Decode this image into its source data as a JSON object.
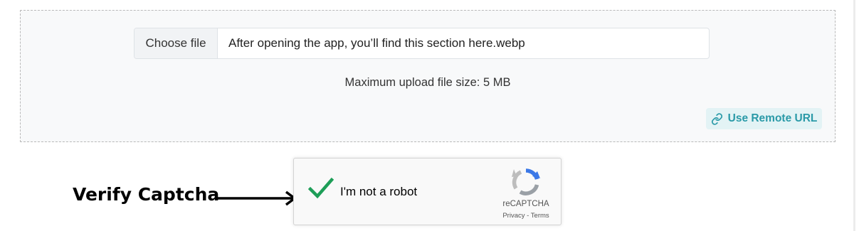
{
  "upload": {
    "choose_file_label": "Choose file",
    "file_name": "After opening the app, you’ll find this section here.webp",
    "max_size_text": "Maximum upload file size: 5 MB",
    "remote_url_label": "Use Remote URL"
  },
  "annotation": {
    "label": "Verify Captcha"
  },
  "recaptcha": {
    "label": "I'm not a robot",
    "brand": "reCAPTCHA",
    "privacy_link": "Privacy",
    "separator": "-",
    "terms_link": "Terms",
    "checked": true
  },
  "colors": {
    "check_green": "#1e9e58",
    "remote_url_teal": "#2a9aa8",
    "zone_background": "#f8f9fa"
  },
  "icons": {
    "remote_url": "link-icon",
    "captcha_checkmark": "checkmark-icon",
    "captcha_logo": "recaptcha-logo-icon",
    "annotation_arrow": "arrow-right-icon"
  }
}
